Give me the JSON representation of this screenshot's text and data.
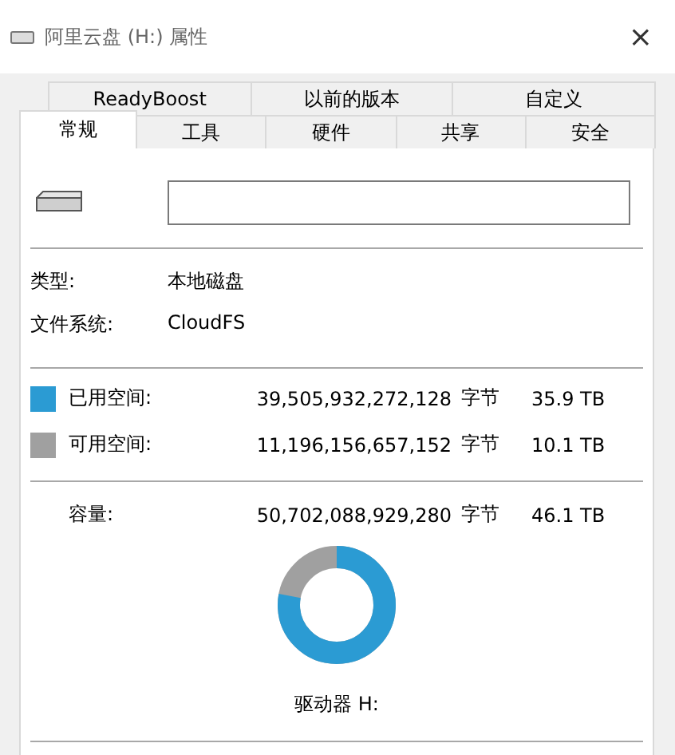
{
  "window": {
    "title": "阿里云盘 (H:) 属性",
    "close": "×"
  },
  "tab_rows": [
    {
      "tabs": [
        {
          "label": "ReadyBoost",
          "selected": false
        },
        {
          "label": "以前的版本",
          "selected": false
        },
        {
          "label": "自定义",
          "selected": false
        }
      ]
    },
    {
      "tabs": [
        {
          "label": "常规",
          "selected": true
        },
        {
          "label": "工具",
          "selected": false
        },
        {
          "label": "硬件",
          "selected": false
        },
        {
          "label": "共享",
          "selected": false
        },
        {
          "label": "安全",
          "selected": false
        }
      ]
    }
  ],
  "info": [
    {
      "label": "类型:",
      "value": "本地磁盘"
    },
    {
      "label": "文件系统:",
      "value": "CloudFS"
    }
  ],
  "space": [
    {
      "label": "已用空间:",
      "bytes": "39,505,932,272,128",
      "unit": "字节",
      "size": "35.9 TB",
      "color": "#2b9bd3"
    },
    {
      "label": "可用空间:",
      "bytes": "11,196,156,657,152",
      "unit": "字节",
      "size": "10.1 TB",
      "color": "#a0a0a0"
    }
  ],
  "capacity": {
    "label": "容量:",
    "bytes": "50,702,088,929,280",
    "unit": "字节",
    "size": "46.1 TB"
  },
  "drive_label": "驱动器 H:"
}
